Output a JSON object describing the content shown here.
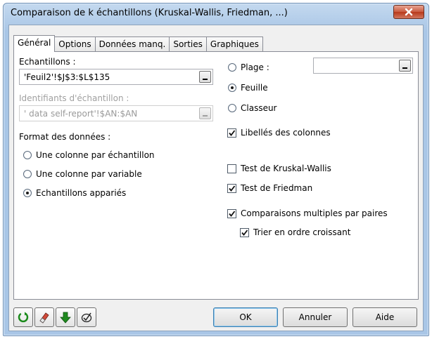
{
  "window": {
    "title": "Comparaison de k échantillons (Kruskal-Wallis, Friedman, ...)"
  },
  "tabs": [
    {
      "label": "Général",
      "active": true
    },
    {
      "label": "Options",
      "active": false
    },
    {
      "label": "Données manq.",
      "active": false
    },
    {
      "label": "Sorties",
      "active": false
    },
    {
      "label": "Graphiques",
      "active": false
    }
  ],
  "general": {
    "samples_label": "Echantillons :",
    "samples_value": "'Feuil2'!$J$3:$L$135",
    "sample_ids_label": "Identifiants d'échantillon :",
    "sample_ids_value": "' data self-report'!$AN:$AN",
    "data_format_label": "Format des données :",
    "data_format_options": [
      {
        "label": "Une colonne par échantillon",
        "selected": false
      },
      {
        "label": "Une colonne par variable",
        "selected": false
      },
      {
        "label": "Echantillons appariés",
        "selected": true
      }
    ],
    "range_options": [
      {
        "label": "Plage :",
        "selected": false
      },
      {
        "label": "Feuille",
        "selected": true
      },
      {
        "label": "Classeur",
        "selected": false
      }
    ],
    "range_value": "",
    "column_labels": {
      "label": "Libellés des colonnes",
      "checked": true
    },
    "kruskal_wallis": {
      "label": "Test de Kruskal-Wallis",
      "checked": false
    },
    "friedman": {
      "label": "Test de Friedman",
      "checked": true
    },
    "multiple_comparisons": {
      "label": "Comparaisons multiples par paires",
      "checked": true
    },
    "sort_ascending": {
      "label": "Trier en ordre croissant",
      "checked": true
    }
  },
  "buttons": {
    "ok": "OK",
    "cancel": "Annuler",
    "help": "Aide"
  },
  "toolbar_icons": [
    "reset-icon",
    "eraser-icon",
    "down-arrow-icon",
    "select-all-icon"
  ],
  "colors": {
    "title_bar": "#a9c6e6",
    "close_button": "#c85a3f",
    "reset_icon": "#1a8a1a",
    "down_arrow_icon": "#1f8a1f"
  }
}
